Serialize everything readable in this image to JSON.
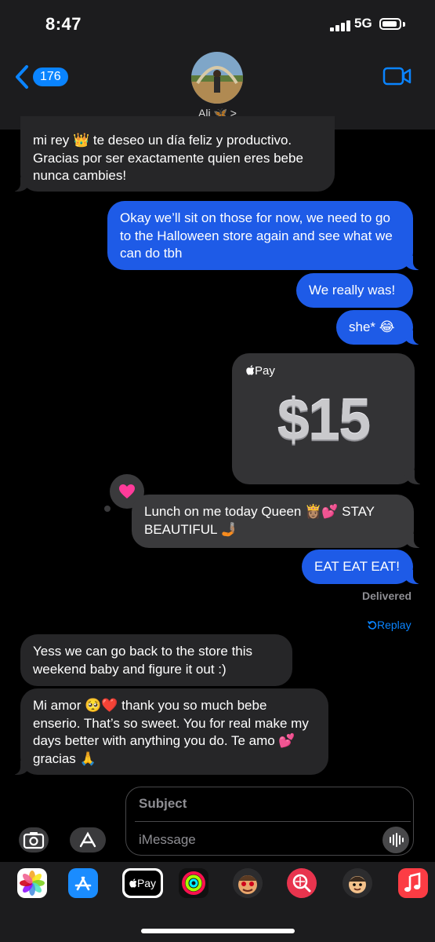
{
  "status_bar": {
    "time": "8:47",
    "network": "5G"
  },
  "header": {
    "back_count": "176",
    "contact_name": "Ali 🦋 >"
  },
  "messages": {
    "m1": "mi rey 👑 te deseo un día feliz y productivo. Gracias por ser exactamente quien eres bebe nunca cambies!",
    "m2": "Okay we’ll sit on those for now, we need to go to the Halloween store again and see what we can do tbh",
    "m3": "We really was!",
    "m4": "she* 😂",
    "m6": "Lunch on me today Queen 👸🏽💕 STAY BEAUTIFUL 🤳🏽",
    "m7": "EAT EAT EAT!",
    "m8": "Yess we can go back to the store this weekend baby and figure it out :)",
    "m9": "Mi amor 🥺❤️ thank you so much bebe enserio. That’s so sweet. You for real make my days better with anything you do. Te amo 💕 gracias 🙏"
  },
  "apple_pay": {
    "label": "Pay",
    "amount": "$15"
  },
  "delivery": {
    "status": "Delivered",
    "replay": "Replay"
  },
  "composer": {
    "subject_placeholder": "Subject",
    "message_placeholder": "iMessage"
  },
  "app_drawer": {
    "apps": [
      "photos-app",
      "app-store-app",
      "apple-pay-app",
      "activity-app",
      "memoji-stickers-app",
      "search-images-app",
      "memoji-app",
      "music-app"
    ],
    "apple_pay_label": "Pay"
  },
  "colors": {
    "outgoing": "#1e5be7",
    "incoming": "#262628",
    "accent": "#0a84ff"
  }
}
